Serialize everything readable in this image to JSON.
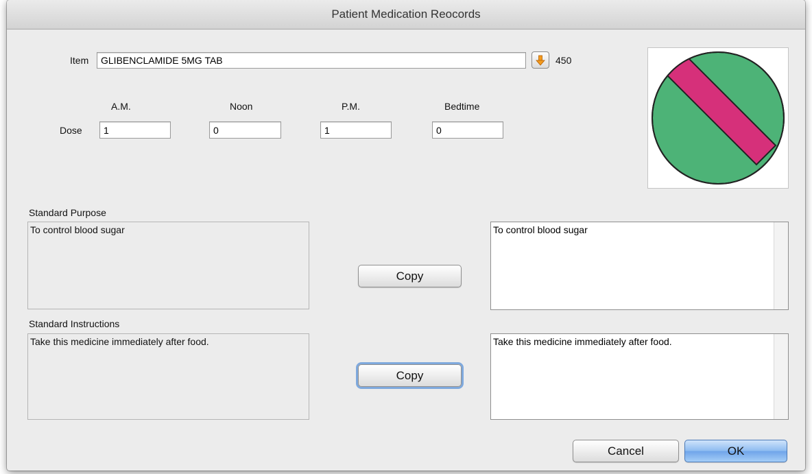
{
  "window": {
    "title": "Patient Medication Reocords"
  },
  "item": {
    "label": "Item",
    "value": "GLIBENCLAMIDE 5MG TAB",
    "count": "450"
  },
  "dose": {
    "label": "Dose",
    "columns": [
      {
        "header": "A.M.",
        "value": "1"
      },
      {
        "header": "Noon",
        "value": "0"
      },
      {
        "header": "P.M.",
        "value": "1"
      },
      {
        "header": "Bedtime",
        "value": "0"
      }
    ]
  },
  "pill": {
    "icon": "pill-icon",
    "body_color": "#4db377",
    "stripe_color": "#d6307a"
  },
  "purpose": {
    "label": "Standard Purpose",
    "standard_text": "To control blood sugar",
    "copy_label": "Copy",
    "edited_text": "To control blood sugar"
  },
  "instructions": {
    "label": "Standard Instructions",
    "standard_text": "Take this medicine immediately after food.",
    "copy_label": "Copy",
    "edited_text": "Take this medicine immediately after food."
  },
  "footer": {
    "cancel_label": "Cancel",
    "ok_label": "OK"
  }
}
